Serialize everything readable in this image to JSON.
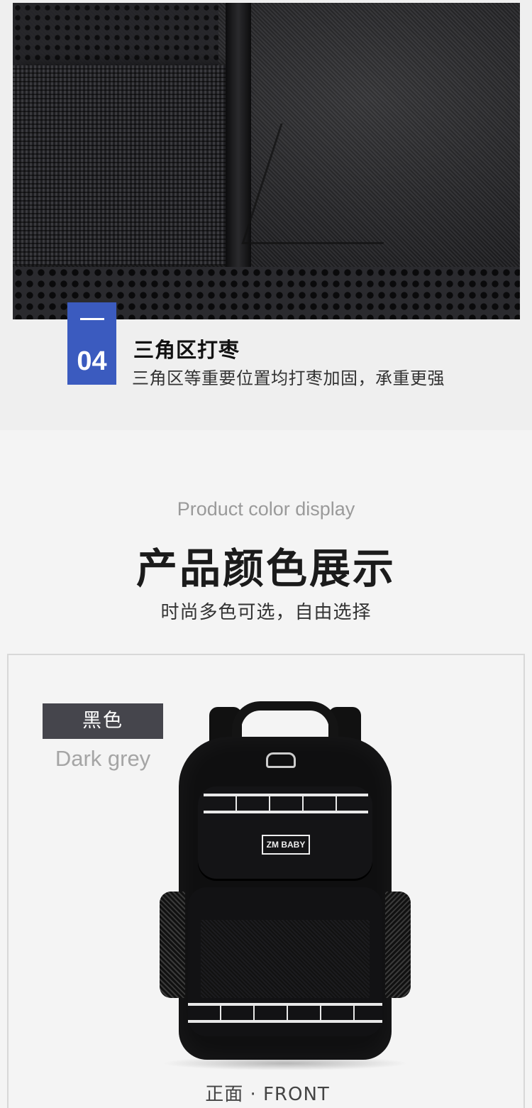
{
  "feature": {
    "number": "04",
    "title": "三角区打枣",
    "description": "三角区等重要位置均打枣加固，承重更强"
  },
  "color_section": {
    "en_subtitle": "Product color display",
    "title": "产品颜色展示",
    "subtitle": "时尚多色可选，自由选择",
    "color_name": "黑色",
    "color_name_en": "Dark grey",
    "brand_label": "ZM BABY",
    "view_label": "正面 · FRONT"
  },
  "colors": {
    "accent": "#3b5bbf",
    "tag_bg": "#45454c"
  }
}
